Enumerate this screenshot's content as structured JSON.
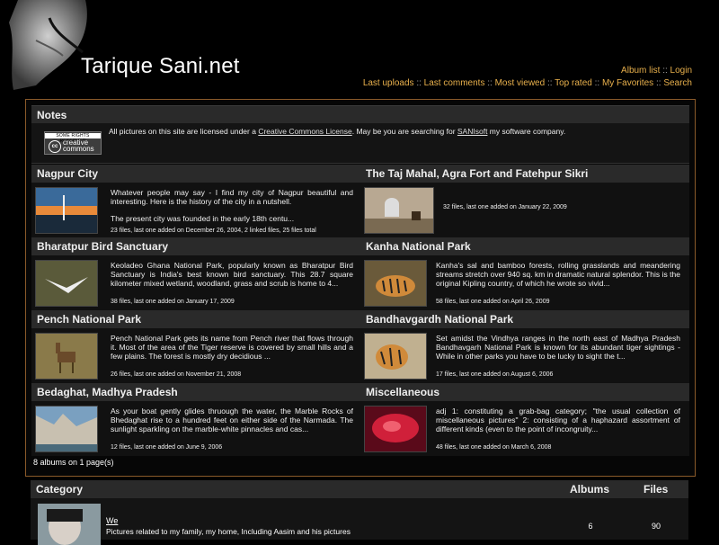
{
  "site": {
    "title": "Tarique Sani.net",
    "links_row1": [
      "Album list",
      "Login"
    ],
    "links_row2": [
      "Last uploads",
      "Last comments",
      "Most viewed",
      "Top rated",
      "My Favorites",
      "Search"
    ],
    "separator": "::"
  },
  "notes": {
    "heading": "Notes",
    "text_before_license": "All pictures on this site are licensed under a ",
    "license_link": "Creative Commons License",
    "text_middle": ". May be you are searching for ",
    "company_link": "SANIsoft",
    "text_after": " my software company.",
    "badge_top": "SOME RIGHTS RESERVED",
    "badge_logo": "cc",
    "badge_word1": "creative",
    "badge_word2": "commons"
  },
  "albums": [
    {
      "title": "Nagpur City",
      "description": "Whatever people may say - I find my city of Nagpur beautiful and interesting. Here is the history of the city in a nutshell.",
      "description2": "The present city was founded in the early 18th centu...",
      "stats": "23 files, last one added on December 26, 2004, 2 linked files, 25 files total",
      "thumb_icon": "sunset-photo"
    },
    {
      "title": "The Taj Mahal, Agra Fort and Fatehpur Sikri",
      "description": "",
      "description2": "",
      "stats": "32 files, last one added on January 22, 2009",
      "thumb_icon": "taj-mahal-photo"
    },
    {
      "title": "Bharatpur Bird Sanctuary",
      "description": "Keoladeo Ghana National Park, popularly known as Bharatpur Bird Sanctuary is India's best known bird sanctuary. This 28.7 square kilometer mixed wetland, woodland, grass and scrub is home to 4...",
      "description2": "",
      "stats": "38 files, last one added on January 17, 2009",
      "thumb_icon": "bird-photo"
    },
    {
      "title": "Kanha National Park",
      "description": "Kanha's sal and bamboo forests, rolling grasslands and meandering streams stretch over 940 sq. km in dramatic natural splendor. This is the original Kipling country, of which he wrote so vivid...",
      "description2": "",
      "stats": "58 files, last one added on April 26, 2009",
      "thumb_icon": "tiger-photo"
    },
    {
      "title": "Pench National Park",
      "description": "Pench National Park gets its name from Pench river that flows through it. Most of the area of the Tiger reserve is covered by small hills and a few plains. The forest is mostly dry decidious ...",
      "description2": "",
      "stats": "26 files, last one added on November 21, 2008",
      "thumb_icon": "deer-photo"
    },
    {
      "title": "Bandhavgardh National Park",
      "description": "Set amidst the Vindhya ranges in the north east of Madhya Pradesh Bandhavgarh National Park is known for its abundant tiger sightings - While in other parks you have to be lucky to sight the t...",
      "description2": "",
      "stats": "17 files, last one added on August 6, 2006",
      "thumb_icon": "tiger-cub-photo"
    },
    {
      "title": "Bedaghat, Madhya Pradesh",
      "description": "As your boat gently glides thruough the water, the Marble Rocks of Bhedaghat rise to a hundred feet on either side of the Narmada. The sunlight sparkling on the marble-white pinnacles and cas...",
      "description2": "",
      "stats": "12 files, last one added on June 9, 2006",
      "thumb_icon": "marble-rocks-photo"
    },
    {
      "title": "Miscellaneous",
      "description": "adj 1: constituting a grab-bag category; \"the usual collection of miscellaneous pictures\" 2: consisting of a haphazard assortment of different kinds (even to the point of incongruity...",
      "description2": "",
      "stats": "48 files, last one added on March 6, 2008",
      "thumb_icon": "red-flower-photo"
    }
  ],
  "albums_count": "8 albums on 1 page(s)",
  "category": {
    "heading": "Category",
    "col_albums": "Albums",
    "col_files": "Files",
    "rows": [
      {
        "name": "We",
        "description": "Pictures related to my family, my home, Including Aasim and his pictures",
        "albums": "6",
        "files": "90"
      }
    ]
  }
}
